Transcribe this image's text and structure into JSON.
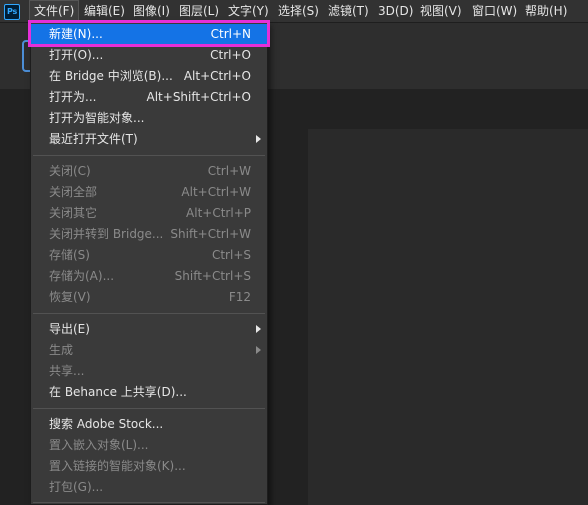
{
  "app": {
    "logo_text": "Ps"
  },
  "menubar": {
    "items": [
      "文件(F)",
      "编辑(E)",
      "图像(I)",
      "图层(L)",
      "文字(Y)",
      "选择(S)",
      "滤镜(T)",
      "3D(D)",
      "视图(V)",
      "窗口(W)",
      "帮助(H)"
    ]
  },
  "file_menu": {
    "items": [
      {
        "label": "新建(N)...",
        "shortcut": "Ctrl+N",
        "enabled": true,
        "highlighted": true
      },
      {
        "label": "打开(O)...",
        "shortcut": "Ctrl+O",
        "enabled": true
      },
      {
        "label": "在 Bridge 中浏览(B)...",
        "shortcut": "Alt+Ctrl+O",
        "enabled": true
      },
      {
        "label": "打开为...",
        "shortcut": "Alt+Shift+Ctrl+O",
        "enabled": true
      },
      {
        "label": "打开为智能对象...",
        "shortcut": "",
        "enabled": true
      },
      {
        "label": "最近打开文件(T)",
        "shortcut": "",
        "enabled": true,
        "submenu": true
      },
      {
        "label": "关闭(C)",
        "shortcut": "Ctrl+W",
        "enabled": false
      },
      {
        "label": "关闭全部",
        "shortcut": "Alt+Ctrl+W",
        "enabled": false
      },
      {
        "label": "关闭其它",
        "shortcut": "Alt+Ctrl+P",
        "enabled": false
      },
      {
        "label": "关闭并转到 Bridge...",
        "shortcut": "Shift+Ctrl+W",
        "enabled": false
      },
      {
        "label": "存储(S)",
        "shortcut": "Ctrl+S",
        "enabled": false
      },
      {
        "label": "存储为(A)...",
        "shortcut": "Shift+Ctrl+S",
        "enabled": false
      },
      {
        "label": "恢复(V)",
        "shortcut": "F12",
        "enabled": false
      },
      {
        "label": "导出(E)",
        "shortcut": "",
        "enabled": true,
        "submenu": true
      },
      {
        "label": "生成",
        "shortcut": "",
        "enabled": false,
        "submenu": true
      },
      {
        "label": "共享...",
        "shortcut": "",
        "enabled": false
      },
      {
        "label": "在 Behance 上共享(D)...",
        "shortcut": "",
        "enabled": true
      },
      {
        "label": "搜索 Adobe Stock...",
        "shortcut": "",
        "enabled": true
      },
      {
        "label": "置入嵌入对象(L)...",
        "shortcut": "",
        "enabled": false
      },
      {
        "label": "置入链接的智能对象(K)...",
        "shortcut": "",
        "enabled": false
      },
      {
        "label": "打包(G)...",
        "shortcut": "",
        "enabled": false
      }
    ]
  },
  "colors": {
    "highlight": "#1473e6",
    "annotation_box": "#e62fd8"
  }
}
